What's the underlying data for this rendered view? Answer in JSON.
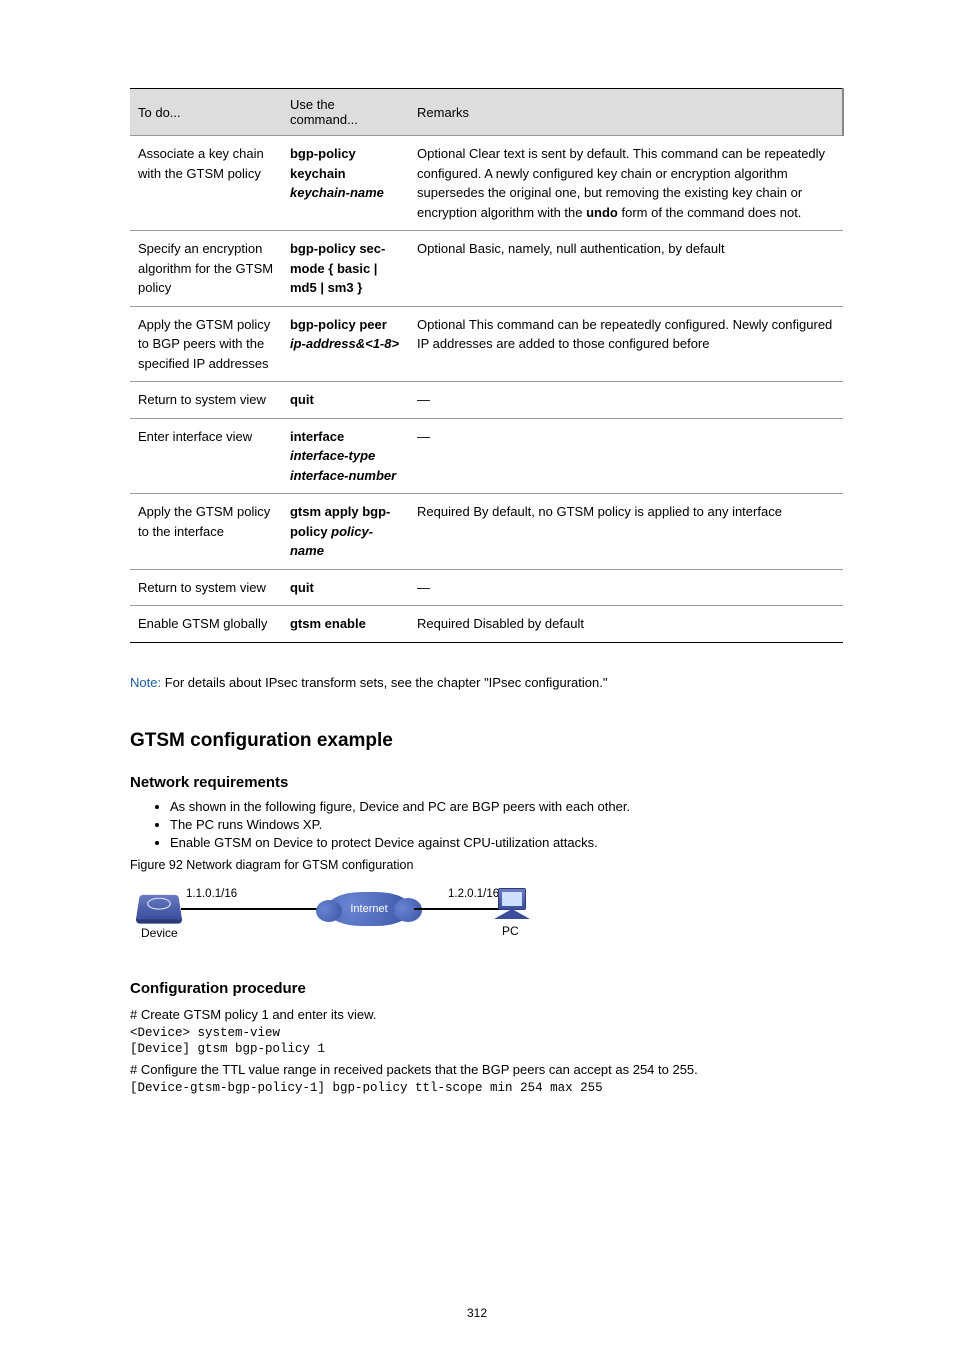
{
  "table": {
    "headers": [
      "To do...",
      "Use the command...",
      "Remarks"
    ],
    "rows": [
      {
        "c1": "Associate a key chain with the GTSM policy",
        "c2_a": "bgp-policy keychain",
        "c2_b": " keychain-name",
        "c3": "Optional\nClear text is sent by default.\nThis command can be repeatedly configured. A newly configured key chain or encryption algorithm supersedes the original one, but removing the existing key chain or encryption algorithm with the ",
        "c3_b": "undo",
        "c3_c": " form of the command does not."
      },
      {
        "c1": "Specify an encryption algorithm for the GTSM policy",
        "c2": "bgp-policy sec-mode { basic | md5 | sm3 }",
        "c3": "Optional\nBasic, namely, null authentication, by default"
      },
      {
        "c1": "Apply the GTSM policy to BGP peers with the specified IP addresses",
        "c2_a": "bgp-policy peer",
        "c2_b": " ip-address&<1-8>",
        "c3": "Optional\nThis command can be repeatedly configured. Newly configured IP addresses are added to those configured before"
      },
      {
        "c1": "Return to system view",
        "c2": "quit",
        "c3": "—"
      },
      {
        "c1": "Enter interface view",
        "c2_a": "interface ",
        "c2_b": "interface-type interface-number",
        "c3": "—"
      },
      {
        "c1": "Apply the GTSM policy to the interface",
        "c2_a": "gtsm apply bgp-policy ",
        "c2_b": "policy-name",
        "c3": "Required\nBy default, no GTSM policy is applied to any interface"
      },
      {
        "c1": "Return to system view",
        "c2": "quit",
        "c3": "—"
      },
      {
        "c1": "Enable GTSM globally",
        "c2": "gtsm enable",
        "c3": "Required\nDisabled by default"
      }
    ]
  },
  "note": {
    "label": "Note:",
    "text": " For details about IPsec transform sets, see the chapter \"IPsec configuration.\""
  },
  "h2": "GTSM configuration example",
  "h3a": "Network requirements",
  "bullets": [
    "As shown in the following figure, Device and PC are BGP peers with each other.",
    "The PC runs Windows XP.",
    "Enable GTSM on Device to protect Device against CPU-utilization attacks."
  ],
  "figcap": "Figure 92 Network diagram for GTSM configuration",
  "diagram": {
    "ip1": "1.1.0.1/16",
    "cloud": "Internet",
    "ip2": "1.2.0.1/16",
    "dev": "Device",
    "pc": "PC"
  },
  "h3b": "Configuration procedure",
  "step1": "# Create GTSM policy 1 and enter its view.",
  "code1": "<Device> system-view",
  "code2": "[Device] gtsm bgp-policy 1",
  "step2": "# Configure the TTL value range in received packets that the BGP peers can accept as 254 to 255.",
  "code3": "[Device-gtsm-bgp-policy-1] bgp-policy ttl-scope min 254 max 255",
  "pagenum": "312"
}
